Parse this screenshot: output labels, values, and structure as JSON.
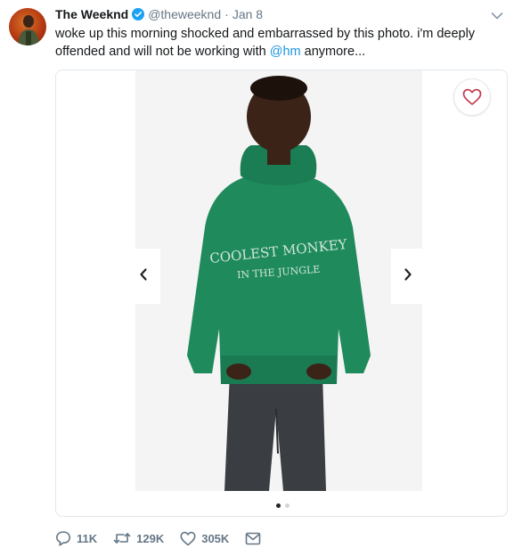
{
  "tweet": {
    "name": "The Weeknd",
    "handle": "@theweeknd",
    "separator": "·",
    "time": "Jan 8",
    "text_before": "woke up this morning shocked and embarrassed by this photo. i'm deeply offended and will not be working with ",
    "mention": "@hm",
    "text_after": " anymore...",
    "colors": {
      "link": "#1b95e0",
      "verified": "#1da1f2",
      "muted": "#657786",
      "hoodie": "#1f8a5c"
    }
  },
  "media": {
    "hoodie_text_line1": "COOLEST MONKEY",
    "hoodie_text_line2": "IN THE JUNGLE",
    "prev_icon": "chevron-left-icon",
    "next_icon": "chevron-right-icon",
    "favorite_icon": "heart-outline-icon",
    "page_indicator": {
      "current": 1,
      "total": 2
    }
  },
  "actions": {
    "reply": {
      "icon": "reply-icon",
      "count": "11K"
    },
    "retweet": {
      "icon": "retweet-icon",
      "count": "129K"
    },
    "like": {
      "icon": "heart-icon",
      "count": "305K"
    },
    "message": {
      "icon": "envelope-icon"
    }
  }
}
